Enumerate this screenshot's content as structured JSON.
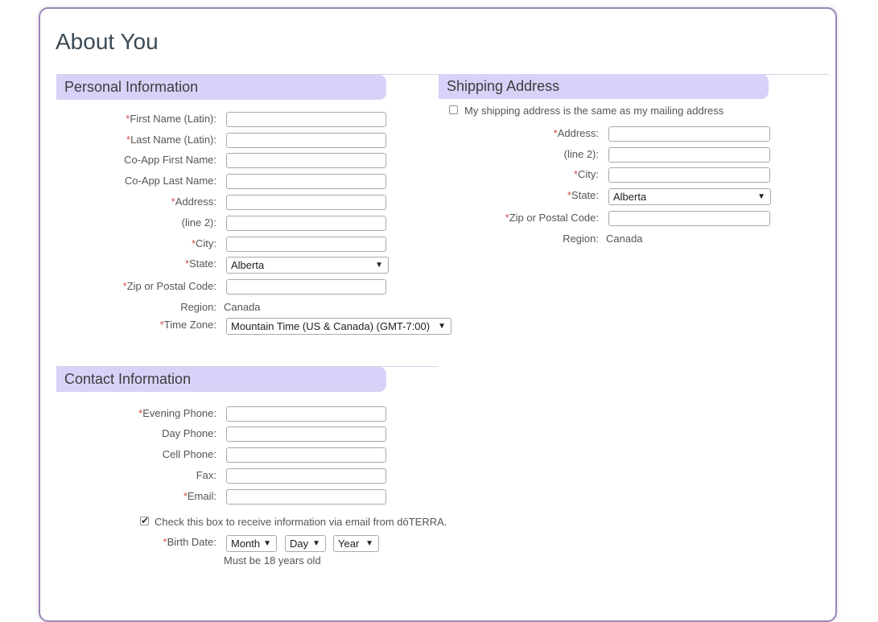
{
  "page": {
    "title": "About You"
  },
  "personal": {
    "heading": "Personal Information",
    "first_name_label": "First Name (Latin):",
    "last_name_label": "Last Name (Latin):",
    "coapp_first_label": "Co-App First Name:",
    "coapp_last_label": "Co-App Last Name:",
    "address_label": "Address:",
    "line2_label": "(line 2):",
    "city_label": "City:",
    "state_label": "State:",
    "state_value": "Alberta",
    "zip_label": "Zip or Postal Code:",
    "region_label": "Region:",
    "region_value": "Canada",
    "timezone_label": "Time Zone:",
    "timezone_value": "Mountain Time (US & Canada) (GMT-7:00)"
  },
  "shipping": {
    "heading": "Shipping Address",
    "same_checkbox_label": "My shipping address is the same as my mailing address",
    "address_label": "Address:",
    "line2_label": "(line 2):",
    "city_label": "City:",
    "state_label": "State:",
    "state_value": "Alberta",
    "zip_label": "Zip or Postal Code:",
    "region_label": "Region:",
    "region_value": "Canada"
  },
  "contact": {
    "heading": "Contact Information",
    "evening_label": "Evening Phone:",
    "day_label": "Day Phone:",
    "cell_label": "Cell Phone:",
    "fax_label": "Fax:",
    "email_label": "Email:",
    "optin_label": "Check this box to receive information via email from dōTERRA.",
    "birth_label": "Birth Date:",
    "month_value": "Month",
    "day_value": "Day",
    "year_value": "Year",
    "age_hint": "Must be 18 years old"
  },
  "symbols": {
    "required": "*",
    "dropdown_arrow": "▼",
    "check": "✔"
  },
  "colors": {
    "section_header": "#d9d1f7",
    "panel_border": "#9a86b8",
    "required": "#d14a4a"
  }
}
